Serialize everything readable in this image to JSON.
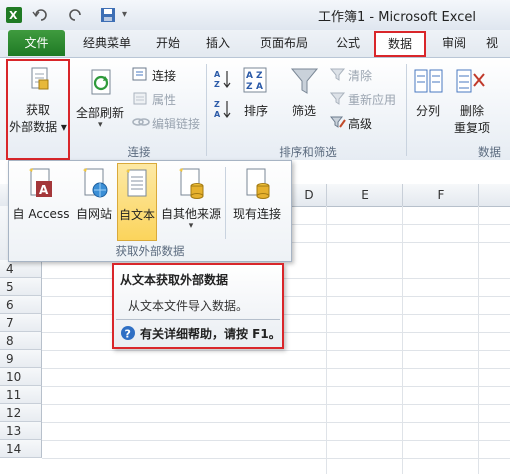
{
  "window": {
    "title": "工作簿1 - Microsoft Excel"
  },
  "colors": {
    "accent_red": "#d9262a",
    "file_tab_green": "#2a8a2e",
    "highlight_yellow": "#fbd45c"
  },
  "tabs": [
    "文件",
    "经典菜单",
    "开始",
    "插入",
    "页面布局",
    "公式",
    "数据",
    "审阅",
    "视"
  ],
  "ribbon": {
    "get_external_data": {
      "line1": "获取",
      "line2": "外部数据 ▾"
    },
    "refresh_all": "全部刷新",
    "connections": "连接",
    "properties": "属性",
    "edit_links": "编辑链接",
    "connections_group": "连接",
    "sort": "排序",
    "filter": "筛选",
    "clear": "清除",
    "reapply": "重新应用",
    "advanced": "高级",
    "sort_filter_group": "排序和筛选",
    "split": "分列",
    "remove": "删除",
    "remove2": "重复项",
    "data_group": "数据"
  },
  "dropdown": {
    "items": [
      "自 Access",
      "自网站",
      "自文本",
      "自其他来源",
      "现有连接"
    ],
    "group_label": "获取外部数据"
  },
  "columns": [
    "D",
    "E",
    "F"
  ],
  "rows": [
    "4",
    "5",
    "6",
    "7",
    "8",
    "9",
    "10",
    "11",
    "12",
    "13",
    "14"
  ],
  "tooltip": {
    "title": "从文本获取外部数据",
    "description": "从文本文件导入数据。",
    "help": "有关详细帮助，请按 F1。"
  }
}
